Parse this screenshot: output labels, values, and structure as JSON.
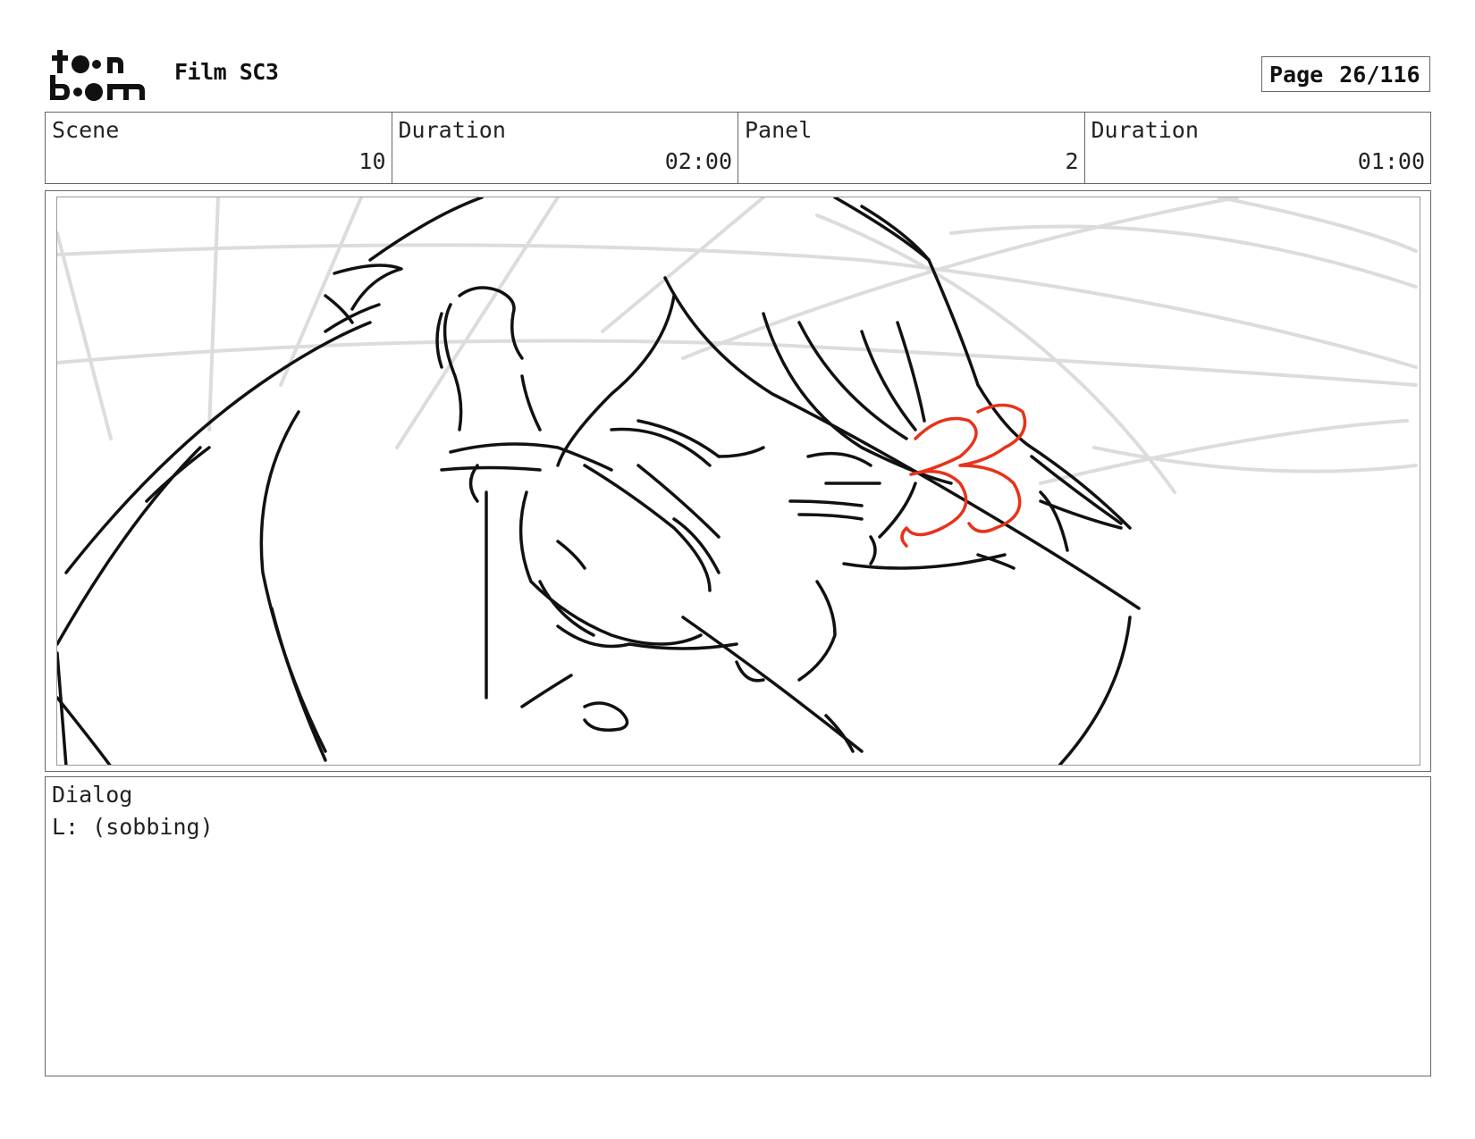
{
  "header": {
    "logo_text_top": "toon",
    "logo_text_bottom": "boom",
    "project_title": "Film SC3",
    "page_label": "Page",
    "page_number": "26/116"
  },
  "info": {
    "scene_label": "Scene",
    "scene_value": "10",
    "scene_duration_label": "Duration",
    "scene_duration_value": "02:00",
    "panel_label": "Panel",
    "panel_value": "2",
    "panel_duration_label": "Duration",
    "panel_duration_value": "01:00"
  },
  "panel": {
    "sketch_icon": "storyboard-sketch",
    "annotation_text": "33",
    "annotation_color": "#e8321a"
  },
  "dialog": {
    "label": "Dialog",
    "text": "L: (sobbing)"
  }
}
